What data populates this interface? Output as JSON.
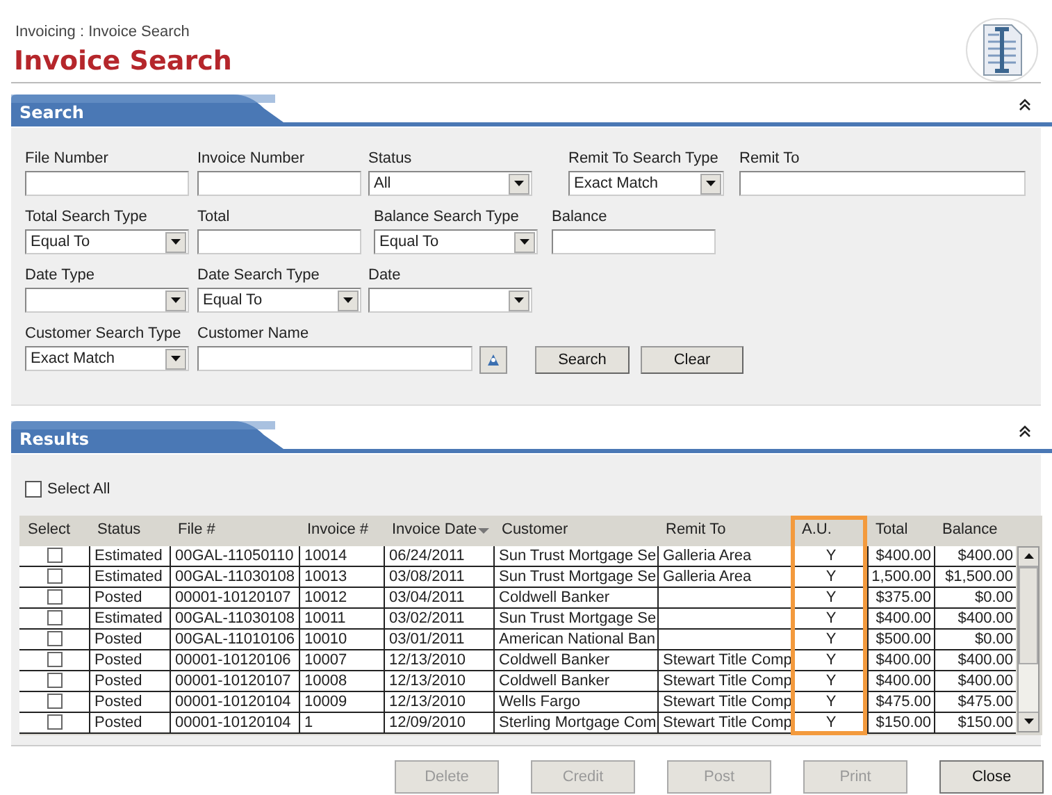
{
  "breadcrumb": "Invoicing : Invoice Search",
  "title": "Invoice Search",
  "search": {
    "title": "Search",
    "expanded": true,
    "rows": [
      [
        {
          "label": "File Number",
          "kind": "text"
        },
        {
          "label": "Invoice Number",
          "kind": "text"
        },
        {
          "label": "Status",
          "kind": "select",
          "value": "All"
        },
        {
          "label": "Remit To Search Type",
          "kind": "select",
          "value": "Exact Match"
        },
        {
          "label": "Remit To",
          "kind": "text"
        }
      ],
      [
        {
          "label": "Total Search Type",
          "kind": "select",
          "value": "Equal To"
        },
        {
          "label": "Total",
          "kind": "text"
        },
        {
          "label": "Balance Search Type",
          "kind": "select",
          "value": "Equal To"
        },
        {
          "label": "Balance",
          "kind": "text"
        }
      ],
      [
        {
          "label": "Date Type",
          "kind": "select"
        },
        {
          "label": "Date Search Type",
          "kind": "select",
          "value": "Equal To"
        },
        {
          "label": "Date",
          "kind": "select"
        }
      ],
      [
        {
          "label": "Customer Search Type",
          "kind": "select",
          "value": "Exact Match"
        },
        {
          "label": "Customer Name",
          "kind": "lookup"
        }
      ]
    ],
    "buttons": [
      {
        "label": "Search",
        "disabled": false
      },
      {
        "label": "Clear",
        "disabled": false
      }
    ]
  },
  "results": {
    "title": "Results",
    "expanded": true,
    "select_all": {
      "label": "Select All",
      "checked": false
    },
    "select_header": "Select",
    "columns": [
      {
        "label": "Status",
        "highlighted": false
      },
      {
        "label": "File #",
        "highlighted": false
      },
      {
        "label": "Invoice #",
        "highlighted": false
      },
      {
        "label": "Invoice Date",
        "highlighted": false,
        "sorted": true
      },
      {
        "label": "Customer",
        "highlighted": false
      },
      {
        "label": "Remit To",
        "highlighted": false
      },
      {
        "label": "A.U.",
        "highlighted": true
      },
      {
        "label": "Total",
        "highlighted": false
      },
      {
        "label": "Balance",
        "highlighted": false
      }
    ],
    "rows": [
      {
        "checked": false,
        "cells": [
          "Estimated",
          "00GAL-11050110",
          "10014",
          "06/24/2011",
          "Sun Trust Mortgage Se",
          "Galleria Area",
          "Y",
          "$400.00",
          "$400.00"
        ]
      },
      {
        "checked": false,
        "cells": [
          "Estimated",
          "00GAL-11030108",
          "10013",
          "03/08/2011",
          "Sun Trust Mortgage Se",
          "Galleria Area",
          "Y",
          "1,500.00",
          "$1,500.00"
        ]
      },
      {
        "checked": false,
        "cells": [
          "Posted",
          "00001-10120107",
          "10012",
          "03/04/2011",
          "Coldwell Banker",
          "",
          "Y",
          "$375.00",
          "$0.00"
        ]
      },
      {
        "checked": false,
        "cells": [
          "Estimated",
          "00GAL-11030108",
          "10011",
          "03/02/2011",
          "Sun Trust Mortgage Se",
          "",
          "Y",
          "$400.00",
          "$400.00"
        ]
      },
      {
        "checked": false,
        "cells": [
          "Posted",
          "00GAL-11010106",
          "10010",
          "03/01/2011",
          "American National Ban",
          "",
          "Y",
          "$500.00",
          "$0.00"
        ]
      },
      {
        "checked": false,
        "cells": [
          "Posted",
          "00001-10120106",
          "10007",
          "12/13/2010",
          "Coldwell Banker",
          "Stewart Title Comp",
          "Y",
          "$400.00",
          "$400.00"
        ]
      },
      {
        "checked": false,
        "cells": [
          "Posted",
          "00001-10120107",
          "10008",
          "12/13/2010",
          "Coldwell Banker",
          "Stewart Title Comp",
          "Y",
          "$400.00",
          "$400.00"
        ]
      },
      {
        "checked": false,
        "cells": [
          "Posted",
          "00001-10120104",
          "10009",
          "12/13/2010",
          "Wells Fargo",
          "Stewart Title Comp",
          "Y",
          "$475.00",
          "$475.00"
        ]
      },
      {
        "checked": false,
        "cells": [
          "Posted",
          "00001-10120104",
          "1",
          "12/09/2010",
          "Sterling Mortgage Com",
          "Stewart Title Comp",
          "Y",
          "$150.00",
          "$150.00"
        ]
      }
    ]
  },
  "buttons": [
    {
      "label": "Delete",
      "disabled": true
    },
    {
      "label": "Credit",
      "disabled": true
    },
    {
      "label": "Post",
      "disabled": true
    },
    {
      "label": "Print",
      "disabled": true
    },
    {
      "label": "Close",
      "disabled": false
    }
  ]
}
